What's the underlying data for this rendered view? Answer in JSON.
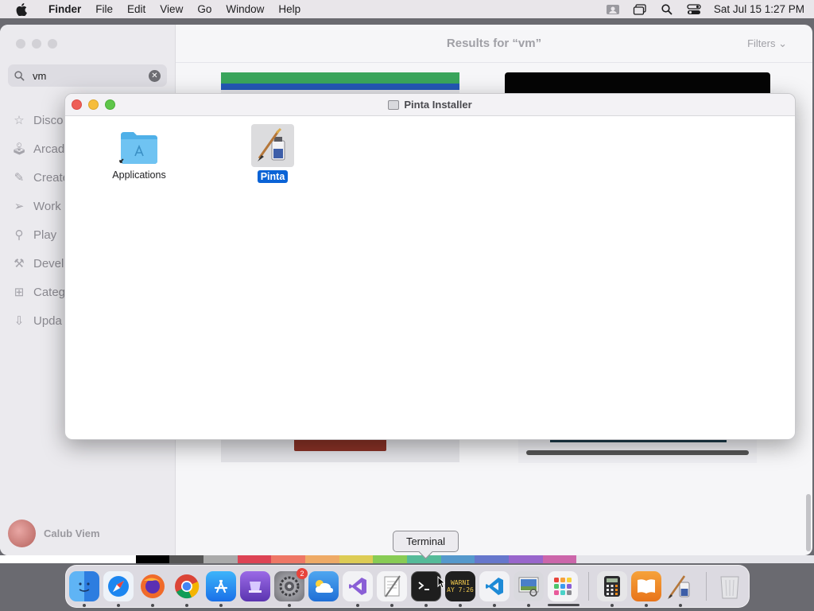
{
  "menubar": {
    "app_name": "Finder",
    "items": [
      "File",
      "Edit",
      "View",
      "Go",
      "Window",
      "Help"
    ],
    "clock": "Sat Jul 15  1:27 PM",
    "status_icons": [
      "user-profile-icon",
      "window-overlap-icon",
      "spotlight-search-icon",
      "control-center-icon"
    ]
  },
  "appstore": {
    "search_value": "vm",
    "header_title": "Results for “vm”",
    "filters_label": "Filters",
    "nav": [
      {
        "label": "Disco",
        "icon": "star-icon"
      },
      {
        "label": "Arcad",
        "icon": "joystick-icon"
      },
      {
        "label": "Create",
        "icon": "brush-icon"
      },
      {
        "label": "Work",
        "icon": "paper-plane-icon"
      },
      {
        "label": "Play",
        "icon": "rocket-icon"
      },
      {
        "label": "Devel",
        "icon": "hammer-icon"
      },
      {
        "label": "Categ",
        "icon": "grid-icon"
      },
      {
        "label": "Upda",
        "icon": "download-icon"
      }
    ],
    "user_name": "Calub Viem"
  },
  "installer": {
    "title": "Pinta Installer",
    "items": [
      {
        "label": "Applications",
        "icon": "applications-folder-icon",
        "selected": false
      },
      {
        "label": "Pinta",
        "icon": "pinta-app-icon",
        "selected": true
      }
    ]
  },
  "tooltip": "Terminal",
  "dock": {
    "items": [
      {
        "name": "finder",
        "color": "#2f8ae8"
      },
      {
        "name": "safari",
        "color": "#1c86f0"
      },
      {
        "name": "firefox",
        "color": "#e8572a"
      },
      {
        "name": "chrome",
        "color": "#ffffff"
      },
      {
        "name": "app-store",
        "color": "#1a8cf0"
      },
      {
        "name": "dock-app-purple",
        "color": "#7b4fc8"
      },
      {
        "name": "system-settings",
        "color": "#8a8a8f",
        "badge": "2"
      },
      {
        "name": "weather",
        "color": "#2f7ee0"
      },
      {
        "name": "visual-studio",
        "color": "#f2f2f5"
      },
      {
        "name": "script-editor",
        "color": "#f4f4f6"
      },
      {
        "name": "terminal",
        "color": "#1e1e1e"
      },
      {
        "name": "console",
        "color": "#1f1f1f",
        "text": "WARNI\nAY 7:26"
      },
      {
        "name": "vscode",
        "color": "#f2f2f5"
      },
      {
        "name": "preview",
        "color": "#d9d9de"
      },
      {
        "name": "launchpad",
        "color": "#f4f4f6"
      },
      {
        "name": "calculator",
        "color": "#e6e6e8"
      },
      {
        "name": "books",
        "color": "#f08a1a"
      },
      {
        "name": "pinta",
        "color": "#e9e9ec"
      },
      {
        "name": "trash",
        "color": "#e9e9ec"
      }
    ]
  },
  "colors": {
    "accent": "#0a63d6",
    "close": "#ee5f57",
    "minimize": "#f6bd3b",
    "maximize": "#5fc64a"
  }
}
